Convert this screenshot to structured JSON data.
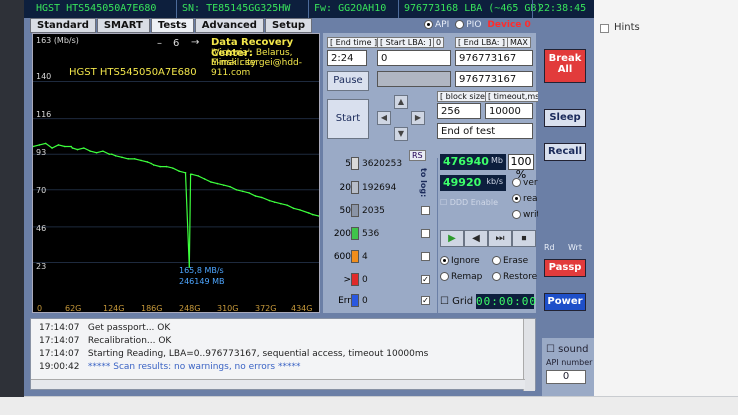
{
  "topbar": {
    "model": "HGST HTS545050A7E680",
    "serial": "SN: TE85145GG325HW",
    "firmware": "Fw: GG2OAH10",
    "lba": "976773168 LBA (~465 GB)",
    "clock": "22:38:45"
  },
  "tabs": [
    "Standard",
    "SMART",
    "Tests",
    "Advanced",
    "Setup"
  ],
  "active_tab": "Tests",
  "mode": {
    "api_label": "API",
    "pio_label": "PIO",
    "device_label": "Device 0",
    "selected": "API"
  },
  "graph": {
    "y_unit": "163 (Mb/s)",
    "drive_label": "HGST HTS545050A7E680",
    "center_line1": "Data Recovery Center:",
    "center_line2": "'Victoria', Belarus, Minsk city",
    "center_line3": "E-mail: sergei@hdd-911.com",
    "dash": "–",
    "step": "6",
    "arrow": "→",
    "cursor_speed": "165,8 MB/s",
    "cursor_mb": "246149 MB"
  },
  "chart_data": {
    "type": "line",
    "title": "",
    "xlabel": "",
    "ylabel": "(Mb/s)",
    "ylim": [
      0,
      163
    ],
    "y_ticks": [
      "140",
      "116",
      "93",
      "70",
      "46",
      "23"
    ],
    "x_ticks": [
      "0",
      "62G",
      "124G",
      "186G",
      "248G",
      "310G",
      "372G",
      "434G"
    ],
    "x_gb": [
      0,
      10,
      20,
      30,
      40,
      50,
      60,
      62,
      70,
      80,
      90,
      100,
      110,
      120,
      124,
      130,
      140,
      150,
      160,
      170,
      180,
      186,
      190,
      200,
      210,
      220,
      230,
      240,
      246,
      248,
      250,
      260,
      270,
      280,
      290,
      300,
      310,
      320,
      330,
      340,
      350,
      360,
      372,
      380,
      390,
      400,
      410,
      420,
      434,
      440,
      450
    ],
    "speed_mbs": [
      98,
      99,
      100,
      97,
      99,
      98,
      98,
      97,
      96,
      97,
      95,
      94,
      95,
      93,
      93,
      92,
      91,
      90,
      90,
      89,
      88,
      87,
      86,
      85,
      85,
      84,
      82,
      81,
      20,
      80,
      80,
      79,
      77,
      75,
      74,
      73,
      72,
      70,
      69,
      68,
      66,
      65,
      63,
      62,
      61,
      60,
      58,
      57,
      55,
      54,
      53
    ]
  },
  "panel": {
    "end_time_label": "[ End time ]",
    "end_time_value": "2:24",
    "start_lba_label": "[ Start LBA: ]",
    "start_lba_tag": "0",
    "start_lba_value": "0",
    "end_lba_label": "[ End LBA: ]",
    "end_lba_max": "MAX",
    "end_lba_value": "976773167",
    "second_field_value": "976773167",
    "pause_label": "Pause",
    "start_label": "Start",
    "block_size_label": "[ block size ]",
    "block_size_value": "256",
    "timeout_label": "[ timeout,ms ]",
    "timeout_value": "10000",
    "end_action": "End of test"
  },
  "blocks": {
    "rs_label": "RS",
    "to_log_label": "to log:",
    "rows": [
      {
        "label": "5",
        "count": "3620253",
        "color": "#d9d9d9"
      },
      {
        "label": "20",
        "count": "192694",
        "color": "#b7bdc8"
      },
      {
        "label": "50",
        "count": "2035",
        "color": "#8a94a6"
      },
      {
        "label": "200",
        "count": "536",
        "color": "#3fc44a"
      },
      {
        "label": "600",
        "count": "4",
        "color": "#f08d1c"
      },
      {
        "label": ">",
        "count": "0",
        "color": "#e02a2a"
      },
      {
        "label": "Err",
        "count": "0",
        "color": "#2a58e0"
      }
    ]
  },
  "results": {
    "mb_value": "476940",
    "mb_unit": "Mb",
    "percent": "100 %",
    "speed_value": "49920",
    "speed_unit": "kb/s",
    "ddd_label": "DDD Enable",
    "verify_label": "verify",
    "read_label": "read",
    "write_label": "write",
    "ignore_label": "Ignore",
    "erase_label": "Erase",
    "remap_label": "Remap",
    "restore_label": "Restore",
    "grid_label": "Grid",
    "timer": "00:00:00"
  },
  "side": {
    "break_all": "Break All",
    "sleep": "Sleep",
    "recall": "Recall",
    "rd": "Rd",
    "wrt": "Wrt",
    "passp": "Passp",
    "power": "Power",
    "hints": "Hints",
    "sound": "sound",
    "api_number_label": "API number",
    "api_number_value": "0"
  },
  "log": [
    {
      "time": "17:14:07",
      "msg": "Get passport... OK",
      "ok": false
    },
    {
      "time": "17:14:07",
      "msg": "Recalibration... OK",
      "ok": false
    },
    {
      "time": "17:14:07",
      "msg": "Starting Reading, LBA=0..976773167, sequential access, timeout 10000ms",
      "ok": false
    },
    {
      "time": "19:00:42",
      "msg": "***** Scan results: no warnings, no errors *****",
      "ok": true
    }
  ]
}
